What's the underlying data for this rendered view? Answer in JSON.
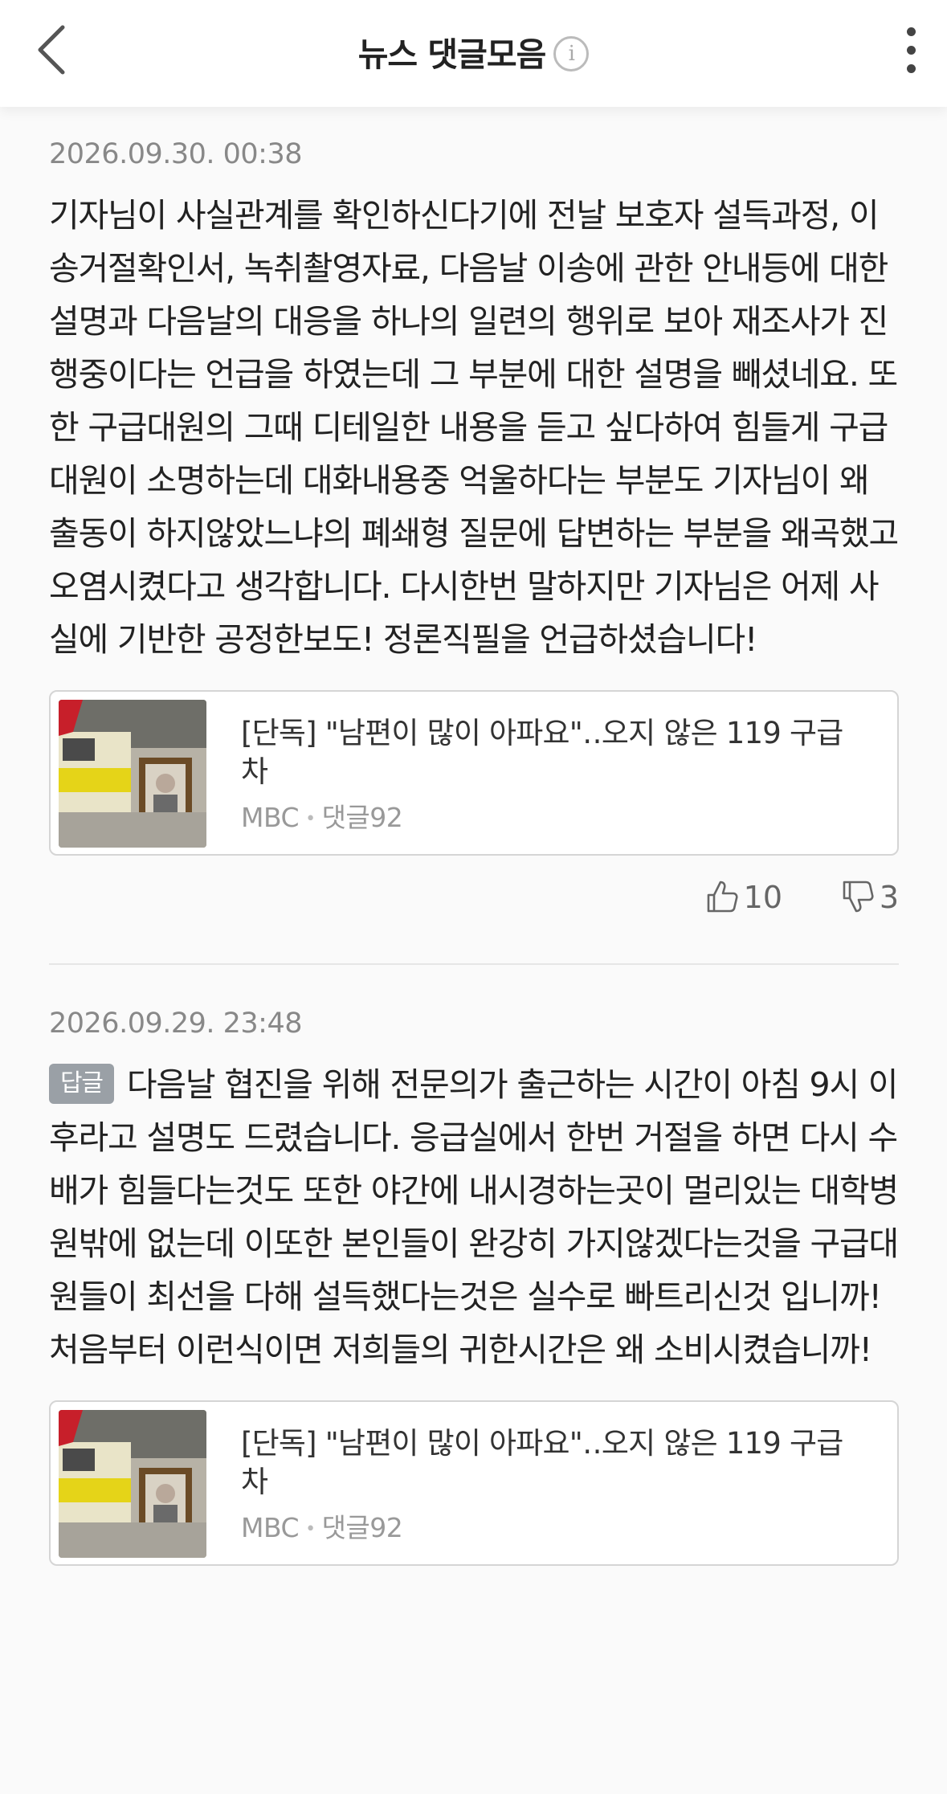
{
  "header": {
    "title": "뉴스 댓글모음",
    "info_icon": "info-circle-icon",
    "back_icon": "chevron-left-icon",
    "more_icon": "vertical-ellipsis-icon"
  },
  "comments": [
    {
      "date": "2026.09.30. 00:38",
      "is_reply": false,
      "text": "기자님이 사실관계를 확인하신다기에 전날 보호자 설득과정, 이송거절확인서, 녹취촬영자료, 다음날 이송에 관한 안내등에 대한 설명과 다음날의 대응을 하나의 일련의 행위로 보아 재조사가 진행중이다는 언급을 하였는데 그 부분에 대한 설명을 빼셨네요. 또한 구급대원의 그때 디테일한 내용을 듣고 싶다하여 힘들게 구급대원이 소명하는데 대화내용중 억울하다는 부분도 기자님이 왜 출동이 하지않았느냐의 폐쇄형 질문에 답변하는 부분을 왜곡했고 오염시켰다고 생각합니다. 다시한번 말하지만 기자님은 어제 사실에 기반한 공정한보도! 정론직필을 언급하셨습니다!",
      "article": {
        "title": "[단독] \"남편이 많이 아파요\"‥오지 않은 119 구급차",
        "source": "MBC",
        "separator": "•",
        "comment_count": "댓글92"
      },
      "likes": "10",
      "dislikes": "3"
    },
    {
      "date": "2026.09.29. 23:48",
      "is_reply": true,
      "reply_label": "답글",
      "text": "다음날 협진을 위해 전문의가 출근하는 시간이 아침 9시 이후라고 설명도 드렸습니다. 응급실에서 한번 거절을 하면 다시 수배가 힘들다는것도 또한 야간에 내시경하는곳이 멀리있는 대학병원밖에 없는데 이또한 본인들이 완강히 가지않겠다는것을 구급대원들이 최선을 다해 설득했다는것은 실수로 빠트리신것 입니까! 처음부터 이런식이면 저희들의 귀한시간은 왜 소비시켰습니까!",
      "article": {
        "title": "[단독] \"남편이 많이 아파요\"‥오지 않은 119 구급차",
        "source": "MBC",
        "separator": "•",
        "comment_count": "댓글92"
      }
    }
  ],
  "icons": {
    "like": "thumbs-up-icon",
    "dislike": "thumbs-down-icon",
    "thumbnail": "ambulance-photo-thumbnail"
  },
  "colors": {
    "background": "#fafafa",
    "text": "#222222",
    "muted": "#888888",
    "badge": "#9aa0a6",
    "border": "#d5d5d5"
  }
}
